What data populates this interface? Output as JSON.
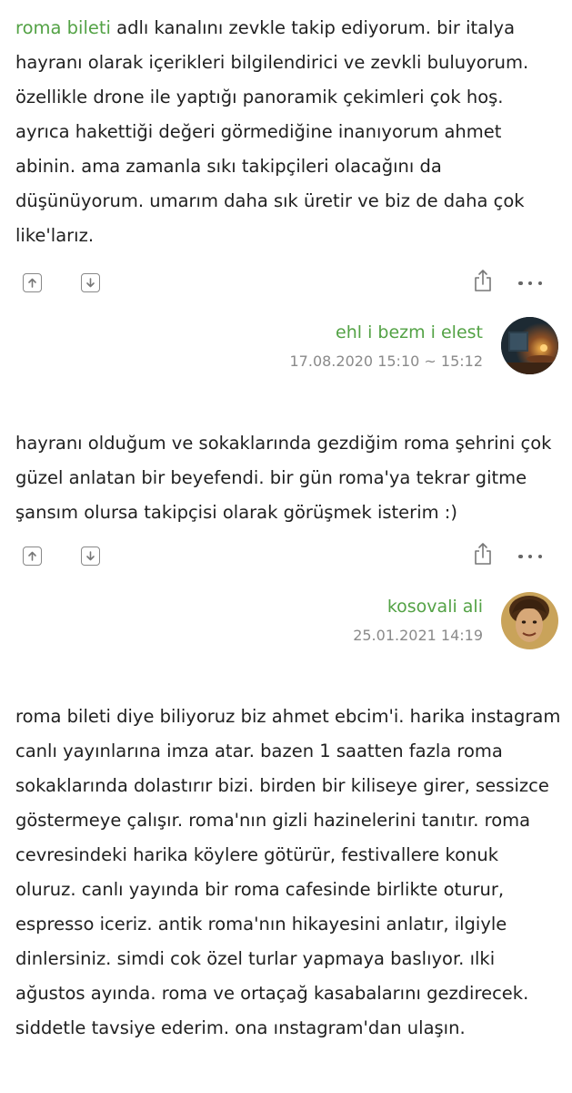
{
  "entries": [
    {
      "link_text": "roma bileti",
      "text_after_link": " adlı kanalını zevkle takip ediyorum. bir italya hayranı olarak içerikleri bilgilendirici ve zevkli buluyorum. özellikle drone ile yaptığı panoramik çekimleri çok hoş. ayrıca hakettiği değeri görmediğine inanıyorum ahmet abinin. ama zamanla sıkı takipçileri olacağını da düşünüyorum. umarım daha sık üretir ve biz de daha çok like'larız.",
      "author": "ehl i bezm i elest",
      "date": "17.08.2020 15:10 ~ 15:12"
    },
    {
      "text": "hayranı olduğum ve sokaklarında gezdiğim roma şehrini çok güzel anlatan bir beyefendi. bir gün roma'ya tekrar gitme şansım olursa takipçisi olarak görüşmek isterim :)",
      "author": "kosovali ali",
      "date": "25.01.2021 14:19"
    },
    {
      "text": "roma bileti diye biliyoruz biz ahmet ebcim'i. harika instagram canlı yayınlarına imza atar. bazen 1 saatten fazla roma sokaklarında dolastırır bizi. birden bir kiliseye girer, sessizce göstermeye çalışır. roma'nın gizli hazinelerini tanıtır. roma cevresindeki harika köylere götürür, festivallere konuk oluruz. canlı yayında bir roma cafesinde birlikte oturur, espresso iceriz. antik roma'nın hikayesini anlatır, ilgiyle dinlersiniz. simdi cok özel turlar yapmaya baslıyor. ılki ağustos ayında. roma ve ortaçağ kasabalarını gezdirecek. siddetle tavsiye ederim. ona ınstagram'dan ulaşın."
    }
  ],
  "colors": {
    "link": "#53a245",
    "date": "#8a8a8a",
    "text": "#1f1f1f",
    "icon": "#888888"
  },
  "icons": [
    "upvote-icon",
    "downvote-icon",
    "share-icon",
    "more-icon"
  ]
}
